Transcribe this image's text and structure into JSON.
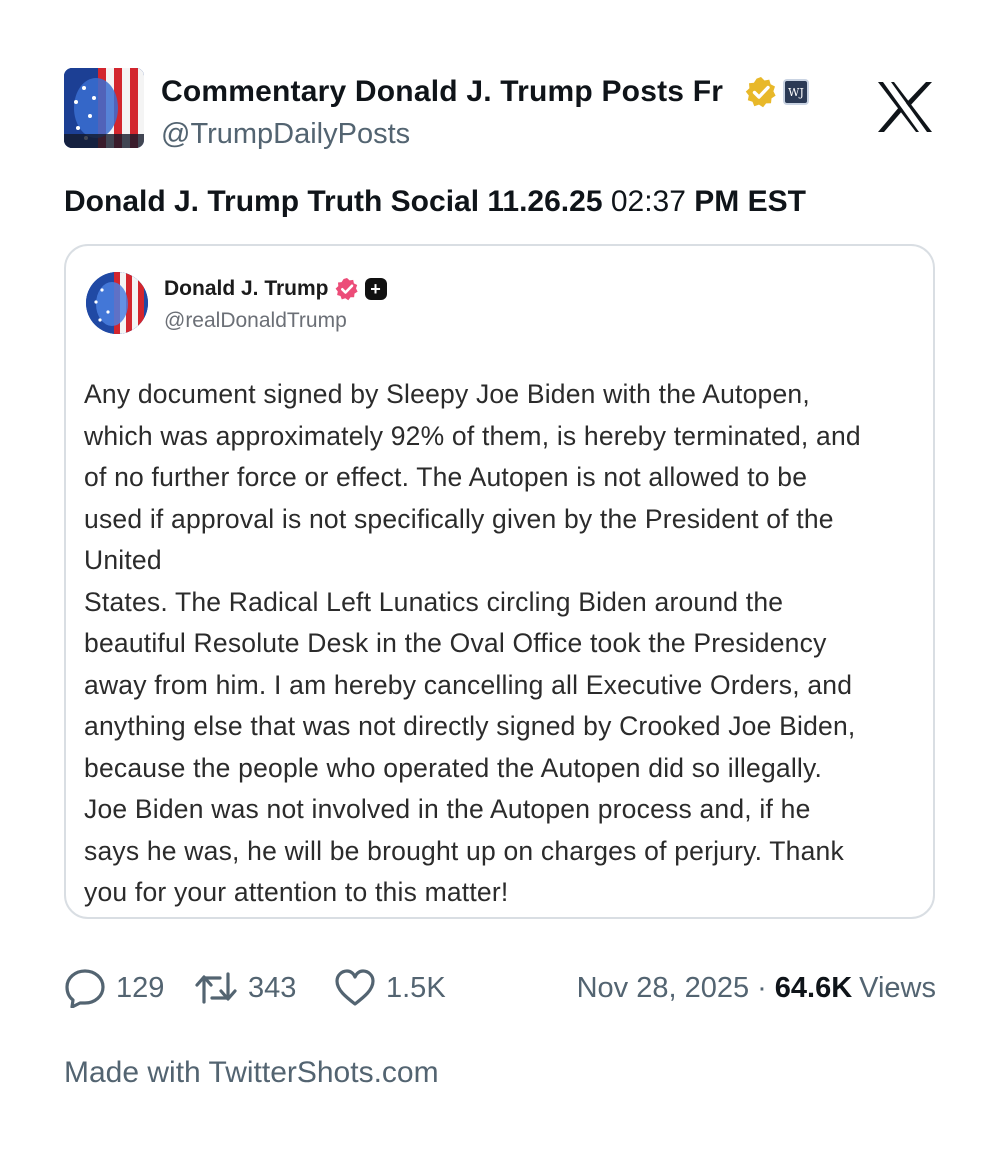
{
  "author": {
    "display_name": "Commentary Donald J. Trump Posts Fr",
    "handle": "@TrumpDailyPosts",
    "verified_badge": "gold-verified-icon",
    "affiliate_badge_text": "WJ"
  },
  "tweet": {
    "text_bold_1": "Donald J. Trump Truth Social 11.26.25",
    "text_time": " 02:37 ",
    "text_bold_2": "PM EST"
  },
  "quoted": {
    "name": "Donald J. Trump",
    "handle": "@realDonaldTrump",
    "body_lines": [
      "Any document signed by Sleepy Joe Biden with the Autopen,",
      "which was approximately 92% of them, is hereby terminated, and",
      "of no further force or effect. The Autopen is not allowed to be",
      "used if approval is not specifically given by the President of the",
      "United",
      "States. The Radical Left Lunatics circling Biden around the",
      "beautiful Resolute Desk in the Oval Office took the Presidency",
      "away from him. I am hereby cancelling all Executive Orders, and",
      "anything else that was not directly signed by Crooked Joe Biden,",
      "because the people who operated the Autopen did so illegally.",
      "Joe Biden was not involved in the Autopen process and, if he",
      "says he was, he will be brought up on charges of perjury. Thank",
      "you for your attention to this matter!"
    ]
  },
  "stats": {
    "replies": "129",
    "reposts": "343",
    "likes": "1.5K",
    "date": "Nov 28, 2025",
    "separator": "·",
    "views_count": "64.6K",
    "views_label": "Views"
  },
  "footer": {
    "made_with": "Made with TwitterShots.com"
  },
  "colors": {
    "text_primary": "#0f1419",
    "text_secondary": "#536471",
    "verified_gold": "#e8b829",
    "verified_pink": "#ec4c78",
    "card_border": "#d9dee3"
  }
}
